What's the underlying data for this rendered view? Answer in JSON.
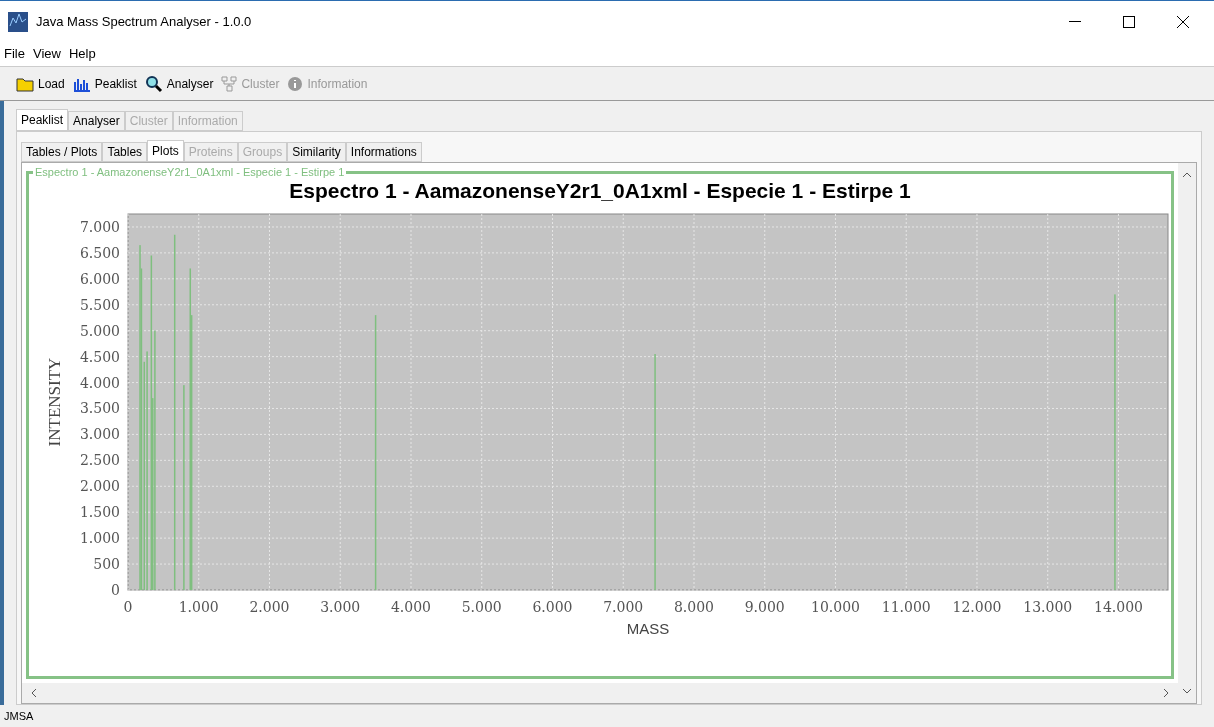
{
  "window": {
    "title": "Java Mass Spectrum Analyser  - 1.0.0"
  },
  "menu": [
    "File",
    "View",
    "Help"
  ],
  "toolbar": [
    {
      "label": "Load",
      "kind": "folder",
      "disabled": false
    },
    {
      "label": "Peaklist",
      "kind": "bars",
      "disabled": false
    },
    {
      "label": "Analyser",
      "kind": "magnifier",
      "disabled": false
    },
    {
      "label": "Cluster",
      "kind": "tree",
      "disabled": true
    },
    {
      "label": "Information",
      "kind": "info",
      "disabled": true
    }
  ],
  "tabs": [
    {
      "label": "Peaklist",
      "selected": true,
      "disabled": false
    },
    {
      "label": "Analyser",
      "selected": false,
      "disabled": false
    },
    {
      "label": "Cluster",
      "selected": false,
      "disabled": true
    },
    {
      "label": "Information",
      "selected": false,
      "disabled": true
    }
  ],
  "subtabs": [
    {
      "label": "Tables / Plots",
      "selected": false,
      "disabled": false
    },
    {
      "label": "Tables",
      "selected": false,
      "disabled": false
    },
    {
      "label": "Plots",
      "selected": true,
      "disabled": false
    },
    {
      "label": "Proteins",
      "selected": false,
      "disabled": true
    },
    {
      "label": "Groups",
      "selected": false,
      "disabled": true
    },
    {
      "label": "Similarity",
      "selected": false,
      "disabled": false
    },
    {
      "label": "Informations",
      "selected": false,
      "disabled": false
    }
  ],
  "panel": {
    "border_title": "Espectro 1 - AamazonenseY2r1_0A1xml - Especie 1 - Estirpe 1",
    "chart_data": {
      "type": "bar",
      "title": "Espectro 1 - AamazonenseY2r1_0A1xml - Especie 1 - Estirpe 1",
      "xlabel": "MASS",
      "ylabel": "INTENSITY",
      "x": [
        170,
        190,
        230,
        270,
        330,
        350,
        380,
        660,
        790,
        880,
        900,
        3500,
        7450,
        13950
      ],
      "grid": true,
      "series": [
        {
          "color": "#7fbf7f",
          "values": [
            6650,
            6200,
            4400,
            4600,
            6450,
            3700,
            5000,
            6850,
            3950,
            6200,
            5300,
            5300,
            4550,
            5700
          ]
        }
      ],
      "xlim": [
        0,
        14700
      ],
      "ylim": [
        0,
        7250
      ],
      "xticks": [
        {
          "value": 0,
          "label": "0"
        },
        {
          "value": 1000,
          "label": "1.000"
        },
        {
          "value": 2000,
          "label": "2.000"
        },
        {
          "value": 3000,
          "label": "3.000"
        },
        {
          "value": 4000,
          "label": "4.000"
        },
        {
          "value": 5000,
          "label": "5.000"
        },
        {
          "value": 6000,
          "label": "6.000"
        },
        {
          "value": 7000,
          "label": "7.000"
        },
        {
          "value": 8000,
          "label": "8.000"
        },
        {
          "value": 9000,
          "label": "9.000"
        },
        {
          "value": 10000,
          "label": "10.000"
        },
        {
          "value": 11000,
          "label": "11.000"
        },
        {
          "value": 12000,
          "label": "12.000"
        },
        {
          "value": 13000,
          "label": "13.000"
        },
        {
          "value": 14000,
          "label": "14.000"
        }
      ],
      "yticks": [
        {
          "value": 0,
          "label": "0"
        },
        {
          "value": 500,
          "label": "500"
        },
        {
          "value": 1000,
          "label": "1.000"
        },
        {
          "value": 1500,
          "label": "1.500"
        },
        {
          "value": 2000,
          "label": "2.000"
        },
        {
          "value": 2500,
          "label": "2.500"
        },
        {
          "value": 3000,
          "label": "3.000"
        },
        {
          "value": 3500,
          "label": "3.500"
        },
        {
          "value": 4000,
          "label": "4.000"
        },
        {
          "value": 4500,
          "label": "4.500"
        },
        {
          "value": 5000,
          "label": "5.000"
        },
        {
          "value": 5500,
          "label": "5.500"
        },
        {
          "value": 6000,
          "label": "6.000"
        },
        {
          "value": 6500,
          "label": "6.500"
        },
        {
          "value": 7000,
          "label": "7.000"
        }
      ]
    }
  },
  "status_bar": "JMSA"
}
